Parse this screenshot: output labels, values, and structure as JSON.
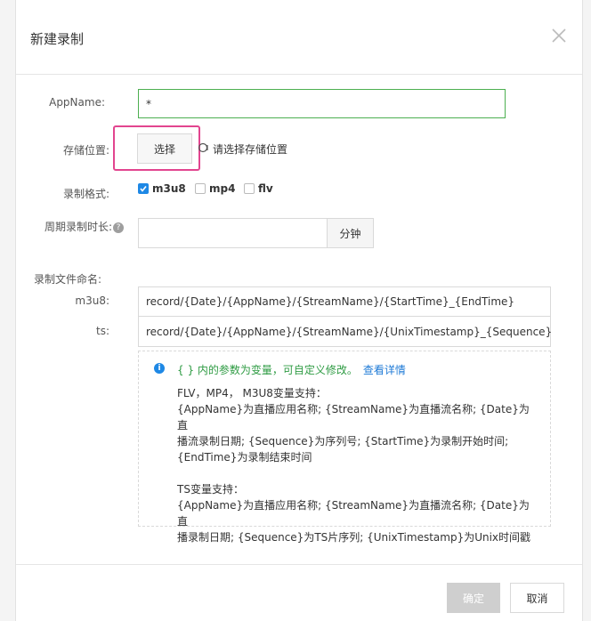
{
  "dialog": {
    "title": "新建录制",
    "close_icon": "close-icon"
  },
  "form": {
    "appname": {
      "label": "AppName:",
      "value": "*"
    },
    "storage": {
      "label": "存储位置:",
      "button": "选择",
      "hint": "请选择存储位置"
    },
    "format": {
      "label": "录制格式:",
      "options": [
        {
          "label": "m3u8",
          "checked": true
        },
        {
          "label": "mp4",
          "checked": false
        },
        {
          "label": "flv",
          "checked": false
        }
      ]
    },
    "period": {
      "label": "周期录制时长:",
      "value": "",
      "unit": "分钟"
    },
    "filename": {
      "label": "录制文件命名:",
      "m3u8_label": "m3u8:",
      "m3u8_value": "record/{Date}/{AppName}/{StreamName}/{StartTime}_{EndTime}",
      "ts_label": "ts:",
      "ts_value": "record/{Date}/{AppName}/{StreamName}/{UnixTimestamp}_{Sequence}"
    }
  },
  "info": {
    "heading": "{ } 内的参数为变量，可自定义修改。",
    "link": "查看详情",
    "lines": [
      "FLV，MP4， M3U8变量支持：",
      "{AppName}为直播应用名称; {StreamName}为直播流名称; {Date}为直",
      "播流录制日期; {Sequence}为序列号; {StartTime}为录制开始时间;",
      "{EndTime}为录制结束时间"
    ],
    "lines2": [
      "TS变量支持：",
      "{AppName}为直播应用名称; {StreamName}为直播流名称; {Date}为直",
      "播录制日期; {Sequence}为TS片序列; {UnixTimestamp}为Unix时间戳"
    ]
  },
  "footer": {
    "confirm": "确定",
    "cancel": "取消"
  },
  "colors": {
    "accent_blue": "#1e88e5",
    "highlight_pink": "#e2458f",
    "active_border_green": "#4caf50",
    "info_green": "#2e9b43"
  }
}
